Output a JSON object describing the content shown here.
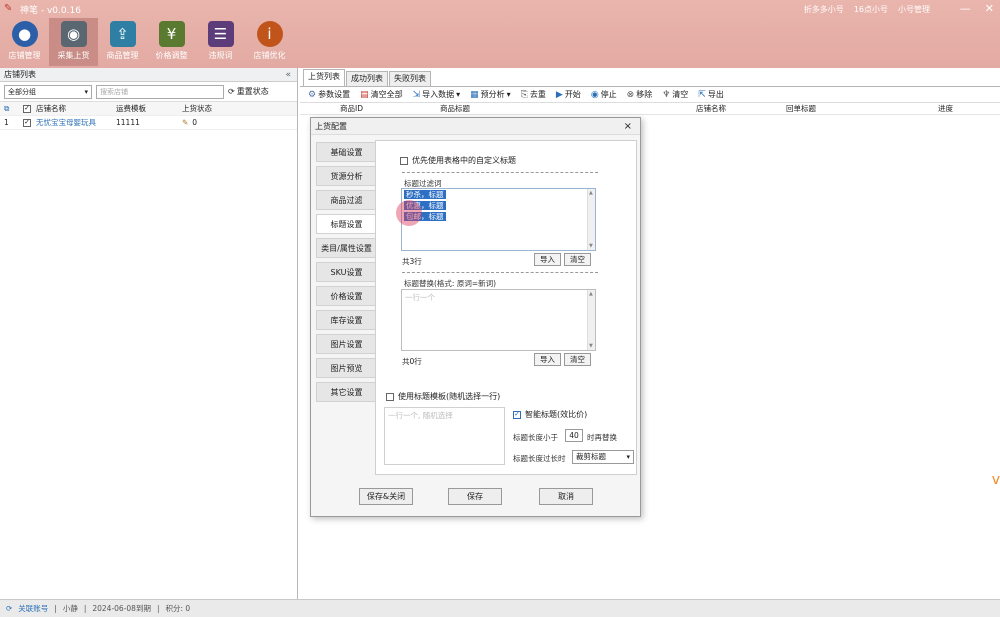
{
  "app": {
    "title": "神笔 - v0.0.16",
    "user_right": "折多多小号",
    "time_right": "16点小号",
    "sub_account": "小号管理",
    "accent": "#e2aaa2"
  },
  "toolbar": [
    {
      "label": "店铺管理",
      "icon": "user-icon",
      "color": "#2d5fa8"
    },
    {
      "label": "采集上货",
      "icon": "robot-icon",
      "color": "#5b6770"
    },
    {
      "label": "商品管理",
      "icon": "upload-box-icon",
      "color": "#2f7fa5"
    },
    {
      "label": "价格调整",
      "icon": "price-doc-icon",
      "color": "#5a7a2f"
    },
    {
      "label": "违规词",
      "icon": "form-icon",
      "color": "#5c3d7a"
    },
    {
      "label": "店铺优化",
      "icon": "info-icon",
      "color": "#c0541a"
    }
  ],
  "left_panel": {
    "title": "店铺列表",
    "group_select": "全部分组",
    "search_placeholder": "搜索店铺",
    "reset_label": "重置状态",
    "columns": [
      "",
      "",
      "店铺名称",
      "运费模板",
      "上货状态"
    ],
    "rows": [
      {
        "index": "1",
        "checked": true,
        "name": "无忧宝宝母婴玩具",
        "template": "11111",
        "status": "0"
      }
    ]
  },
  "right_area": {
    "tabs": [
      "上货列表",
      "成功列表",
      "失败列表"
    ],
    "toolbar": [
      {
        "label": "参数设置",
        "icon": "gear-icon"
      },
      {
        "label": "清空全部",
        "icon": "clear-icon"
      },
      {
        "label": "导入数据",
        "icon": "import-icon",
        "has_dropdown": true
      },
      {
        "label": "预分析",
        "icon": "analyze-icon",
        "has_dropdown": true
      },
      {
        "label": "去重",
        "icon": "dedupe-icon"
      },
      {
        "label": "开始",
        "icon": "play-icon"
      },
      {
        "label": "停止",
        "icon": "stop-icon"
      },
      {
        "label": "移除",
        "icon": "remove-icon"
      },
      {
        "label": "清空",
        "icon": "broom-icon"
      },
      {
        "label": "导出",
        "icon": "export-icon"
      }
    ],
    "columns": [
      "商品ID",
      "商品标题",
      "店铺名称",
      "回单标题",
      "进度"
    ]
  },
  "dialog": {
    "title": "上货配置",
    "nav": [
      "基础设置",
      "货源分析",
      "商品过滤",
      "标题设置",
      "类目/属性设置",
      "SKU设置",
      "价格设置",
      "库存设置",
      "图片设置",
      "图片预览",
      "其它设置"
    ],
    "active_nav": 3,
    "prefer_custom_title": "优先使用表格中的自定义标题",
    "filter_words_label": "标题过滤词",
    "filter_words": [
      "秒杀，标题",
      "优惠，标题",
      "包邮，标题"
    ],
    "filter_count": "共3行",
    "import_label": "导入",
    "clear_label": "清空",
    "replace_label": "标题替换(格式: 原词=新词)",
    "replace_placeholder": "一行一个",
    "replace_count": "共0行",
    "use_template_label": "使用标题模板(随机选择一行)",
    "template_placeholder": "一行一个, 随机选择",
    "smart_title_label": "智能标题(效比价)",
    "min_length_prefix": "标题长度小于",
    "min_length_value": "40",
    "min_length_suffix": "时再替换",
    "overlength_label": "标题长度过长时",
    "overlength_value": "裁剪标题",
    "buttons": [
      "保存&关闭",
      "保存",
      "取消"
    ]
  },
  "statusbar": {
    "login_status": "关联账号",
    "user": "小静",
    "expiry": "2024-06-08到期",
    "points": "积分: 0"
  }
}
